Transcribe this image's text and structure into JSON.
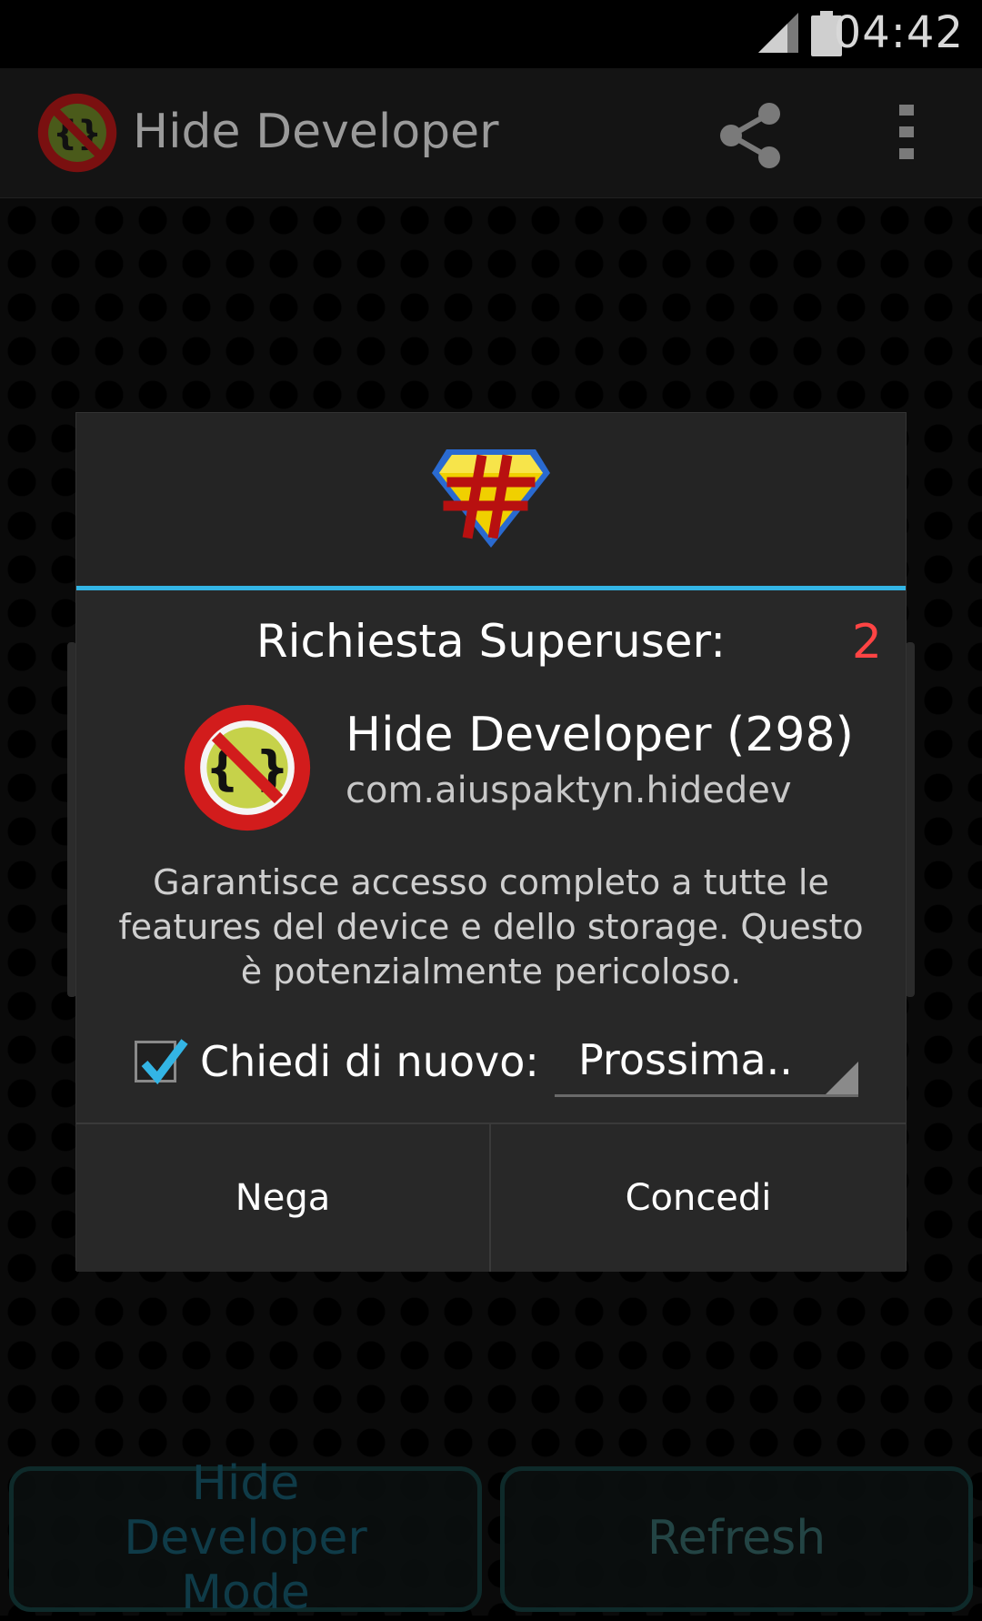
{
  "status_bar": {
    "time": "04:42",
    "icons": [
      "signal-icon",
      "battery-icon"
    ]
  },
  "action_bar": {
    "title": "Hide Developer",
    "icons": [
      "app-icon",
      "share-icon",
      "overflow-menu-icon"
    ]
  },
  "dialog": {
    "logo": "superuser-icon",
    "title": "Richiesta Superuser:",
    "count": "2",
    "app_name": "Hide Developer (298)",
    "package_name": "com.aiuspaktyn.hidedev",
    "warning": "Garantisce accesso completo a tutte le features del device e dello storage. Questo è potenzialmente pericoloso.",
    "ask_again_label": "Chiedi di nuovo:",
    "ask_again_checked": true,
    "duration_value": "Prossima..",
    "deny_label": "Nega",
    "grant_label": "Concedi"
  },
  "bottom_buttons": {
    "hide_developer_mode": "Hide Developer Mode",
    "refresh": "Refresh"
  },
  "colors": {
    "accent": "#33b5e5",
    "count": "#ff4444",
    "dialog_bg": "#282828",
    "action_bar_bg": "#141414"
  }
}
